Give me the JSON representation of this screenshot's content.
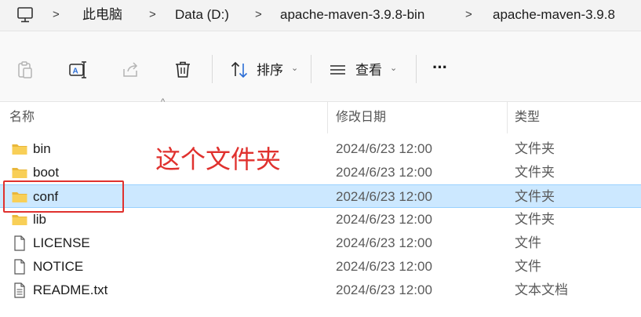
{
  "breadcrumb": {
    "items": [
      "此电脑",
      "Data (D:)",
      "apache-maven-3.9.8-bin",
      "apache-maven-3.9.8"
    ],
    "separator": ">",
    "root_icon": "monitor-icon"
  },
  "toolbar": {
    "copy_icon": "clipboard-icon",
    "rename_icon": "rename-icon",
    "share_icon": "share-icon",
    "delete_icon": "trash-icon",
    "sort_label": "排序",
    "view_label": "查看",
    "more_label": "···"
  },
  "columns": {
    "name": "名称",
    "modified": "修改日期",
    "type": "类型"
  },
  "files": [
    {
      "name": "bin",
      "date": "2024/6/23 12:00",
      "type": "文件夹",
      "icon": "folder-icon"
    },
    {
      "name": "boot",
      "date": "2024/6/23 12:00",
      "type": "文件夹",
      "icon": "folder-icon"
    },
    {
      "name": "conf",
      "date": "2024/6/23 12:00",
      "type": "文件夹",
      "icon": "folder-icon",
      "selected": true
    },
    {
      "name": "lib",
      "date": "2024/6/23 12:00",
      "type": "文件夹",
      "icon": "folder-icon"
    },
    {
      "name": "LICENSE",
      "date": "2024/6/23 12:00",
      "type": "文件",
      "icon": "file-icon"
    },
    {
      "name": "NOTICE",
      "date": "2024/6/23 12:00",
      "type": "文件",
      "icon": "file-icon"
    },
    {
      "name": "README.txt",
      "date": "2024/6/23 12:00",
      "type": "文本文档",
      "icon": "text-file-icon"
    }
  ],
  "annotation": {
    "text": "这个文件夹",
    "color": "#e0312e"
  },
  "colors": {
    "selection": "#cce8ff",
    "selection_border": "#99d1ff",
    "folder": "#f4c542"
  }
}
